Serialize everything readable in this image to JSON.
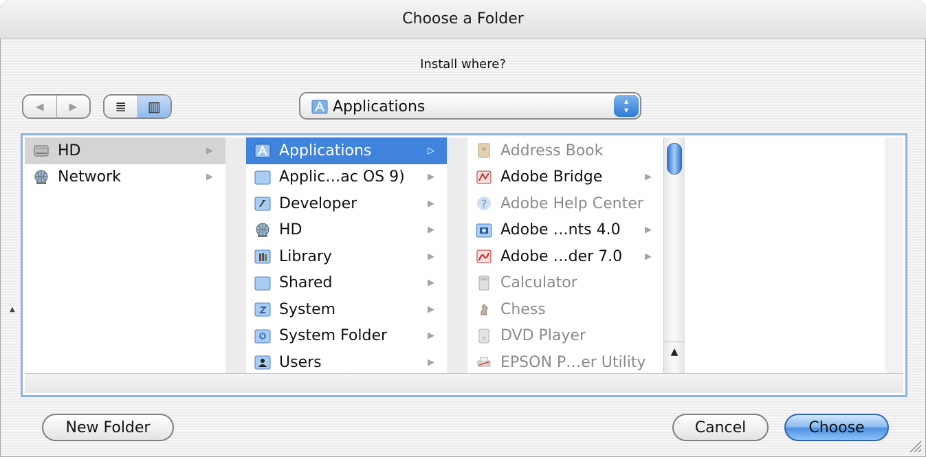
{
  "window": {
    "title": "Choose a Folder"
  },
  "prompt": "Install where?",
  "toolbar": {
    "back_glyph": "◀",
    "forward_glyph": "▶",
    "list_view_glyph": "≣",
    "column_view_glyph": "▥",
    "location_popup": {
      "selected": "Applications",
      "stepper_up": "▴",
      "stepper_down": "▾"
    }
  },
  "columns": [
    {
      "items": [
        {
          "label": "HD",
          "icon": "hard-drive-icon",
          "arrow": "▶",
          "state": "selected-inactive"
        },
        {
          "label": "Network",
          "icon": "network-globe-icon",
          "arrow": "▶",
          "state": "normal"
        }
      ]
    },
    {
      "items": [
        {
          "label": "Applications",
          "icon": "applications-folder-icon",
          "arrow": "▷",
          "state": "selected"
        },
        {
          "label": "Applic…ac OS 9)",
          "icon": "folder-icon",
          "arrow": "▶",
          "state": "normal"
        },
        {
          "label": "Developer",
          "icon": "developer-folder-icon",
          "arrow": "▶",
          "state": "normal"
        },
        {
          "label": "HD",
          "icon": "network-globe-icon",
          "arrow": "▶",
          "state": "normal"
        },
        {
          "label": "Library",
          "icon": "library-folder-icon",
          "arrow": "▶",
          "state": "normal"
        },
        {
          "label": "Shared",
          "icon": "folder-icon",
          "arrow": "▶",
          "state": "normal"
        },
        {
          "label": "System",
          "icon": "system-folder-icon",
          "arrow": "▶",
          "state": "normal"
        },
        {
          "label": "System Folder",
          "icon": "system9-folder-icon",
          "arrow": "▶",
          "state": "normal"
        },
        {
          "label": "Users",
          "icon": "users-folder-icon",
          "arrow": "▶",
          "state": "normal"
        }
      ]
    },
    {
      "items": [
        {
          "label": "Address Book",
          "icon": "address-book-icon",
          "arrow": "",
          "state": "disabled"
        },
        {
          "label": "Adobe Bridge",
          "icon": "adobe-bridge-icon",
          "arrow": "▶",
          "state": "normal"
        },
        {
          "label": "Adobe Help Center",
          "icon": "help-center-icon",
          "arrow": "",
          "state": "disabled"
        },
        {
          "label": "Adobe …nts 4.0",
          "icon": "adobe-elements-icon",
          "arrow": "▶",
          "state": "normal"
        },
        {
          "label": "Adobe …der 7.0",
          "icon": "adobe-reader-icon",
          "arrow": "▶",
          "state": "normal"
        },
        {
          "label": "Calculator",
          "icon": "calculator-icon",
          "arrow": "",
          "state": "disabled"
        },
        {
          "label": "Chess",
          "icon": "chess-icon",
          "arrow": "",
          "state": "disabled"
        },
        {
          "label": "DVD Player",
          "icon": "dvd-player-icon",
          "arrow": "",
          "state": "disabled"
        },
        {
          "label": "EPSON P…er Utility",
          "icon": "printer-utility-icon",
          "arrow": "",
          "state": "disabled"
        }
      ]
    }
  ],
  "scrollbar": {
    "arrow_up": "▲"
  },
  "buttons": {
    "new_folder": "New Folder",
    "cancel": "Cancel",
    "choose": "Choose"
  },
  "colors": {
    "selection": "#3f83dc",
    "default_button": "#4f93e4",
    "focus_ring": "#8cb3e6"
  }
}
